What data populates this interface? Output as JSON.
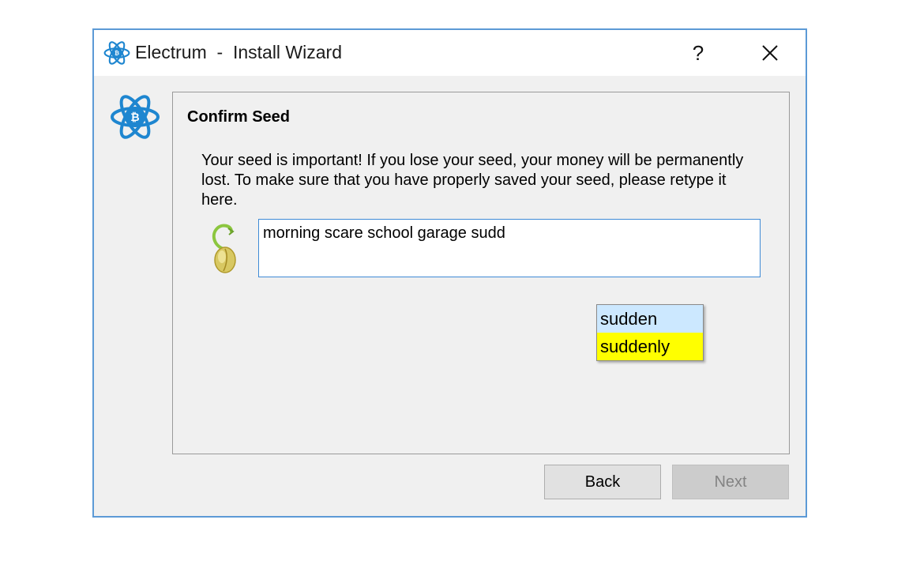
{
  "window": {
    "title": "Electrum  -  Install Wizard",
    "help_label": "?",
    "close_label": "✕"
  },
  "colors": {
    "accent": "#3e8ad6",
    "logo_blue": "#1e86d0",
    "highlight": "#ffff00",
    "hover": "#cce8ff"
  },
  "panel": {
    "title": "Confirm Seed",
    "message": "Your seed is important! If you lose your seed, your money will be permanently lost. To make sure that you have properly saved your seed, please retype it here.",
    "seed_value": "morning scare school garage sudd"
  },
  "completer": {
    "items": [
      {
        "label": "sudden",
        "state": "hover"
      },
      {
        "label": "suddenly",
        "state": "selected"
      }
    ]
  },
  "buttons": {
    "back": "Back",
    "next": "Next"
  },
  "icons": {
    "title_logo": "electrum-logo-icon",
    "side_logo": "electrum-logo-icon",
    "seed": "seed-icon"
  }
}
